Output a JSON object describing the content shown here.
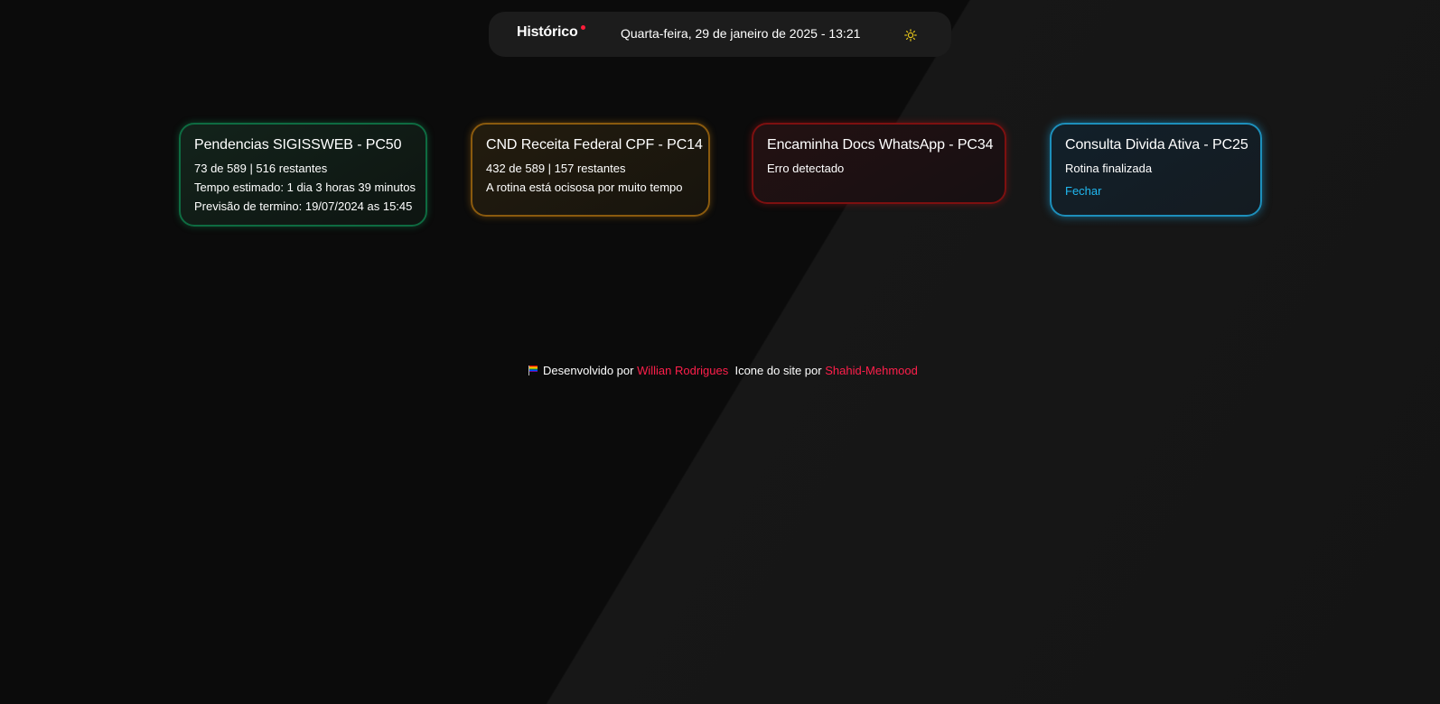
{
  "header": {
    "brand": "Histórico",
    "datetime": "Quarta-feira, 29 de janeiro de 2025 - 13:21",
    "theme_icon": "sun-icon"
  },
  "cards": [
    {
      "title": "Pendencias SIGISSWEB - PC50",
      "lines": [
        "73 de 589 | 516 restantes",
        "Tempo estimado: 1 dia 3 horas 39 minutos",
        "Previsão de termino: 19/07/2024 as 15:45"
      ],
      "status_color": "#0e6b41"
    },
    {
      "title": "CND Receita Federal CPF - PC14",
      "lines": [
        "432 de 589 | 157 restantes",
        "A rotina está ocisosa por muito tempo"
      ],
      "status_color": "#8a5a0e"
    },
    {
      "title": "Encaminha Docs WhatsApp - PC34",
      "lines": [
        "Erro detectado"
      ],
      "status_color": "#7d1010"
    },
    {
      "title": "Consulta Divida Ativa - PC25",
      "lines": [
        "Rotina finalizada"
      ],
      "action_label": "Fechar",
      "status_color": "#1d8fbb"
    }
  ],
  "footer": {
    "flag_icon": "rainbow-flag-icon",
    "developed_by_text": "Desenvolvido por",
    "developer_name": "Willian Rodrigues",
    "icon_credit_text": "Icone do site por",
    "icon_author": "Shahid-Mehmood"
  },
  "colors": {
    "accent_link": "#ff1f4b",
    "notification_dot": "#ff1d3a",
    "success": "#0e6b41",
    "warning": "#8a5a0e",
    "error": "#7d1010",
    "finished": "#1d8fbb"
  }
}
